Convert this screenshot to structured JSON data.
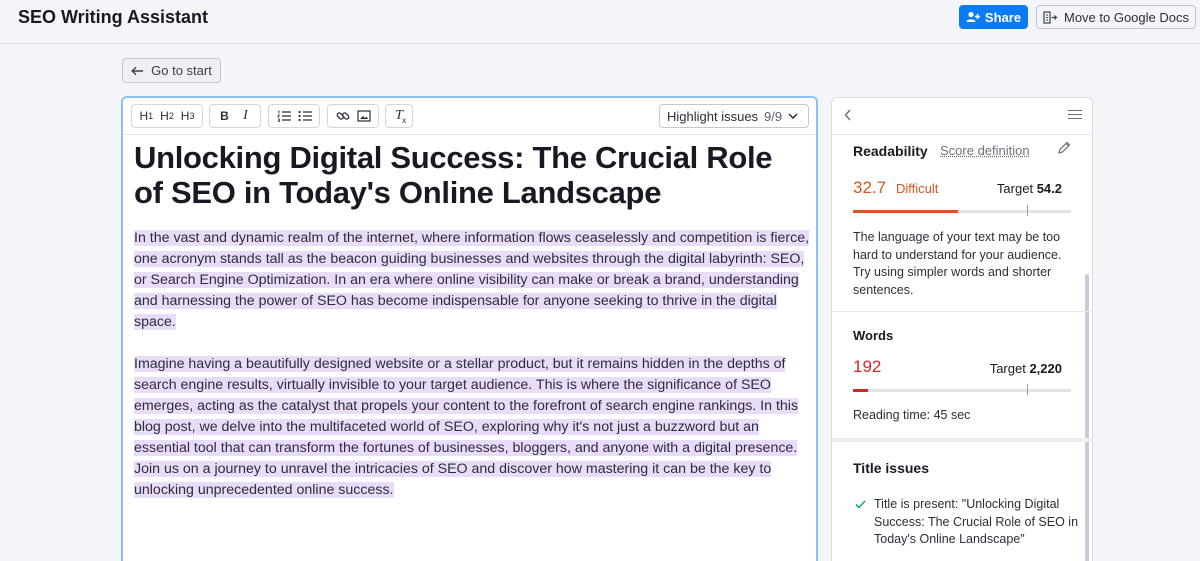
{
  "header": {
    "app_title": "SEO Writing Assistant",
    "share_label": "Share",
    "move_label": "Move to Google Docs"
  },
  "nav": {
    "go_to_start_label": "Go to start"
  },
  "toolbar": {
    "h1": "H",
    "h1_sub": "1",
    "h2": "H",
    "h2_sub": "2",
    "h3": "H",
    "h3_sub": "3",
    "bold": "B",
    "italic": "I",
    "clear_format": "T",
    "highlight_label": "Highlight issues",
    "highlight_count": "9/9"
  },
  "document": {
    "title": "Unlocking Digital Success: The Crucial Role of SEO in Today's Online Landscape",
    "paragraphs": [
      "In the vast and dynamic realm of the internet, where information flows ceaselessly and competition is fierce, one acronym stands tall as the beacon guiding businesses and websites through the digital labyrinth: SEO, or Search Engine Optimization. In an era where online visibility can make or break a brand, understanding and harnessing the power of SEO has become indispensable for anyone seeking to thrive in the digital space.",
      "Imagine having a beautifully designed website or a stellar product, but it remains hidden in the depths of search engine results, virtually invisible to your target audience. This is where the significance of SEO emerges, acting as the catalyst that propels your content to the forefront of search engine rankings. In this blog post, we delve into the multifaceted world of SEO, exploring why it's not just a buzzword but an essential tool that can transform the fortunes of businesses, bloggers, and anyone with a digital presence. Join us on a journey to unravel the intricacies of SEO and discover how mastering it can be the key to unlocking unprecedented online success."
    ]
  },
  "panel": {
    "readability": {
      "title": "Readability",
      "score_definition": "Score definition",
      "score": "32.7",
      "score_label": "Difficult",
      "target_prefix": "Target",
      "target_value": "54.2",
      "progress_fraction": 0.48,
      "target_fraction": 0.8,
      "description": "The language of your text may be too hard to understand for your audience. Try using simpler words and shorter sentences."
    },
    "words": {
      "title": "Words",
      "value": "192",
      "target_prefix": "Target",
      "target_value": "2,220",
      "progress_fraction": 0.07,
      "target_fraction": 0.8,
      "reading_time": "Reading time: 45 sec"
    },
    "title_issues": {
      "title": "Title issues",
      "item": "Title is present: \"Unlocking Digital Success: The Crucial Role of SEO in Today's Online Landscape\""
    }
  },
  "colors": {
    "accent_blue": "#0a7cf3",
    "difficult_orange": "#d85620",
    "words_red": "#d02828",
    "highlight_purple": "#eadcf8",
    "check_green": "#1fa67a"
  },
  "icons": [
    "add-user-icon",
    "google-docs-export-icon",
    "arrow-left-icon",
    "ordered-list-icon",
    "unordered-list-icon",
    "link-icon",
    "image-icon",
    "clear-format-icon",
    "chevron-down-icon",
    "chevron-left-icon",
    "menu-icon",
    "pencil-icon",
    "check-icon"
  ]
}
